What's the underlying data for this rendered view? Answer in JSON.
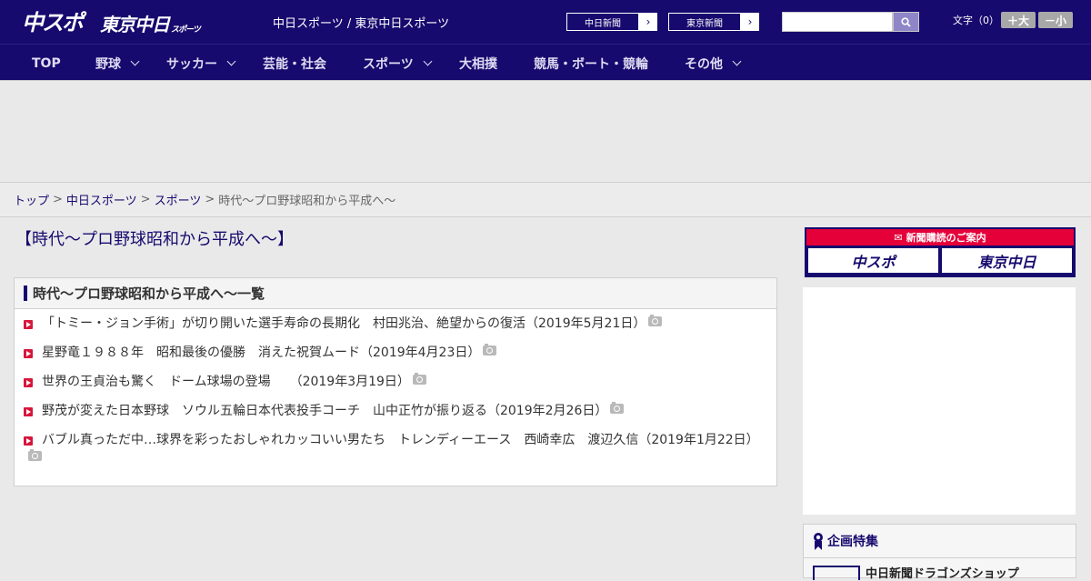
{
  "header": {
    "logo_main": "中スポ",
    "logo_tokyo": "東京中日",
    "logo_tokyo_sub": "スポーツ",
    "site_title": "中日スポーツ / 東京中日スポーツ",
    "paper_buttons": [
      "中日新聞",
      "東京新聞"
    ],
    "search": {
      "placeholder": "",
      "value": ""
    },
    "font_size_label": "文字（0）",
    "font_larger": "＋大",
    "font_smaller": "－小"
  },
  "nav": {
    "items": [
      {
        "label": "TOP",
        "dropdown": false
      },
      {
        "label": "野球",
        "dropdown": true
      },
      {
        "label": "サッカー",
        "dropdown": true
      },
      {
        "label": "芸能・社会",
        "dropdown": false
      },
      {
        "label": "スポーツ",
        "dropdown": true
      },
      {
        "label": "大相撲",
        "dropdown": false
      },
      {
        "label": "競馬・ボート・競輪",
        "dropdown": false
      },
      {
        "label": "その他",
        "dropdown": true
      }
    ]
  },
  "breadcrumb": {
    "items": [
      "トップ",
      "中日スポーツ",
      "スポーツ"
    ],
    "current": "時代～プロ野球昭和から平成へ～",
    "separator": ">"
  },
  "main": {
    "page_title": "【時代～プロ野球昭和から平成へ～】",
    "list_heading": "時代～プロ野球昭和から平成へ～一覧",
    "articles": [
      {
        "title": "「トミー・ジョン手術」が切り開いた選手寿命の長期化　村田兆治、絶望からの復活（2019年5月21日）",
        "has_photo": true
      },
      {
        "title": "星野竜１９８８年　昭和最後の優勝　消えた祝賀ムード（2019年4月23日）",
        "has_photo": true
      },
      {
        "title": "世界の王貞治も驚く　ドーム球場の登場　　（2019年3月19日）",
        "has_photo": true
      },
      {
        "title": "野茂が変えた日本野球　ソウル五輪日本代表投手コーチ　山中正竹が振り返る（2019年2月26日）",
        "has_photo": true
      },
      {
        "title": "バブル真っただ中…球界を彩ったおしゃれカッコいい男たち　トレンディーエース　西崎幸広　渡辺久信（2019年1月22日）",
        "has_photo": true
      }
    ]
  },
  "sidebar": {
    "subscription_banner": {
      "title": "新聞購読のご案内",
      "buttons": [
        "中スポ",
        "東京中日"
      ]
    },
    "feature": {
      "heading": "企画特集",
      "first_item": "中日新聞ドラゴンズショップ"
    }
  },
  "colors": {
    "brand_navy": "#160a6e",
    "accent_red": "#e50039",
    "background": "#e9e9e9"
  }
}
